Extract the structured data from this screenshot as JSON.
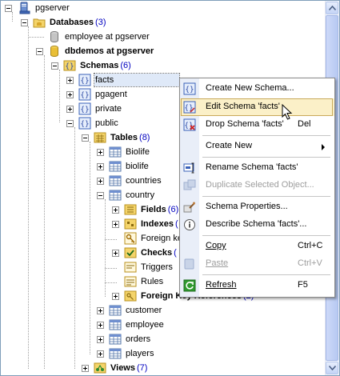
{
  "tree": {
    "server": "pgserver",
    "databases": {
      "label": "Databases",
      "count": "(3)"
    },
    "employee_db": "employee at pgserver",
    "dbdemos": "dbdemos at pgserver",
    "schemas": {
      "label": "Schemas",
      "count": "(6)"
    },
    "schema_items": [
      "facts",
      "pgagent",
      "private",
      "public"
    ],
    "tables": {
      "label": "Tables",
      "count": "(8)"
    },
    "table_items_top": [
      "Biolife",
      "biolife",
      "countries",
      "country"
    ],
    "fields": {
      "label": "Fields",
      "count": "(6)"
    },
    "indexes": {
      "label": "Indexes",
      "count": "("
    },
    "foreign_keys_partial": "Foreign ke",
    "checks": {
      "label": "Checks",
      "count": "("
    },
    "triggers": "Triggers",
    "rules": "Rules",
    "foreign_key_references": {
      "label": "Foreign Key References",
      "count": "(2)"
    },
    "table_items_bottom": [
      "customer",
      "employee",
      "orders",
      "players"
    ],
    "views": {
      "label": "Views",
      "count": "(7)"
    }
  },
  "menu": {
    "create_new_schema": "Create New Schema...",
    "edit_schema": "Edit Schema 'facts'",
    "drop_schema": "Drop Schema 'facts'",
    "drop_key": "Del",
    "create_new": "Create New",
    "rename_schema": "Rename Schema 'facts'",
    "duplicate": "Duplicate Selected Object...",
    "properties": "Schema Properties...",
    "describe": "Describe Schema 'facts'...",
    "copy": "Copy",
    "copy_key": "Ctrl+C",
    "paste": "Paste",
    "paste_key": "Ctrl+V",
    "refresh": "Refresh",
    "refresh_key": "F5"
  },
  "colors": {
    "count": "#0000c0",
    "menu_hover": "#fbf0c8",
    "disabled": "#9d9d9d"
  }
}
